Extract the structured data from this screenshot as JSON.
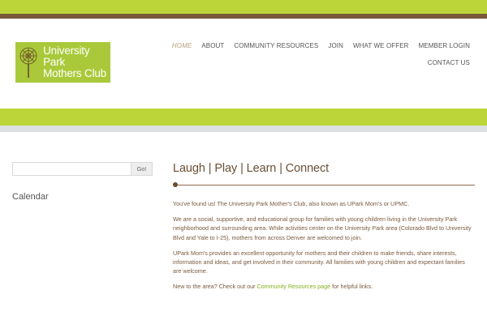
{
  "header": {
    "logo_line1": "University Park",
    "logo_line2": "Mothers Club"
  },
  "nav": {
    "row1": [
      {
        "label": "HOME",
        "active": true
      },
      {
        "label": "ABOUT"
      },
      {
        "label": "COMMUNITY RESOURCES"
      },
      {
        "label": "JOIN"
      },
      {
        "label": "WHAT WE OFFER"
      },
      {
        "label": "MEMBER LOGIN"
      }
    ],
    "row2": [
      {
        "label": "CONTACT US"
      }
    ]
  },
  "sidebar": {
    "search_placeholder": "",
    "search_button": "Go!",
    "calendar_title": "Calendar"
  },
  "main": {
    "title": "Laugh | Play | Learn | Connect",
    "p1": "You've found us! The University Park Mother's Club, also known as  UPark Mom's or UPMC.",
    "p2": "We are a social, supportive, and educational group for families with young children living in the University Park neighborhood and surrounding area. While activities center on the University Park area (Colorado Blvd to University Blvd and Yale to I-25), mothers from across Denver are welcomed to join.",
    "p3": "UPark Mom's provides an excellent opportunity for mothers and their children to make friends, share interests, information and ideas, and get involved in their community. All families with young children and expectant families are welcome.",
    "p4_before": "New to the area? Check out our ",
    "p4_link": "Community Resources page",
    "p4_after": " for helpful links."
  },
  "colors": {
    "brand_green": "#bcd63a",
    "brand_brown": "#7a5a3a",
    "link_green": "#85b01e"
  }
}
